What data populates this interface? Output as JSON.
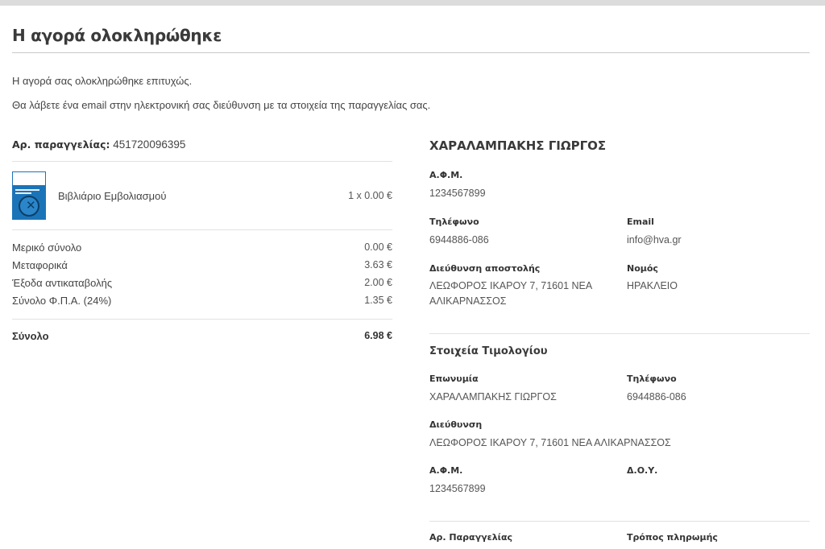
{
  "page": {
    "title": "Η αγορά ολοκληρώθηκε",
    "message_success": "Η αγορά σας ολοκληρώθηκε επιτυχώς.",
    "message_email": "Θα λάβετε ένα email στην ηλεκτρονική σας διεύθυνση με τα στοιχεία της παραγγελίας σας."
  },
  "order": {
    "number_label": "Αρ. παραγγελίας:",
    "number_value": "451720096395",
    "items": [
      {
        "name": "Βιβλιάριο Εμβολιασμού",
        "qty_price": "1 x 0.00 €",
        "thumb_icon": "vaccination-booklet-thumbnail"
      }
    ],
    "summary": [
      {
        "label": "Μερικό σύνολο",
        "value": "0.00 €"
      },
      {
        "label": "Μεταφορικά",
        "value": "3.63 €"
      },
      {
        "label": "Έξοδα αντικαταβολής",
        "value": "2.00 €"
      },
      {
        "label": "Σύνολο Φ.Π.Α. (24%)",
        "value": "1.35 €"
      }
    ],
    "total": {
      "label": "Σύνολο",
      "value": "6.98 €"
    }
  },
  "customer": {
    "name": "ΧΑΡΑΛΑΜΠΑΚΗΣ ΓΙΩΡΓΟΣ",
    "afm_label": "Α.Φ.Μ.",
    "afm_value": "1234567899",
    "phone_label": "Τηλέφωνο",
    "phone_value": "6944886-086",
    "email_label": "Email",
    "email_value": "info@hva.gr",
    "shipping_label": "Διεύθυνση αποστολής",
    "shipping_line1": "ΛΕΩΦΟΡΟΣ ΙΚΑΡΟΥ 7, 71601 ΝΕΑ",
    "shipping_line2": "ΑΛΙΚΑΡΝΑΣΣΟΣ",
    "nomos_label": "Νομός",
    "nomos_value": "ΗΡΑΚΛΕΙΟ"
  },
  "invoice": {
    "title": "Στοιχεία Τιμολογίου",
    "company_label": "Επωνυμία",
    "company_value": "ΧΑΡΑΛΑΜΠΑΚΗΣ ΓΙΩΡΓΟΣ",
    "phone_label": "Τηλέφωνο",
    "phone_value": "6944886-086",
    "address_label": "Διεύθυνση",
    "address_value": "ΛΕΩΦΟΡΟΣ ΙΚΑΡΟΥ 7, 71601 ΝΕΑ ΑΛΙΚΑΡΝΑΣΣΟΣ",
    "afm_label": "Α.Φ.Μ.",
    "afm_value": "1234567899",
    "doy_label": "Δ.Ο.Υ.",
    "doy_value": ""
  },
  "extra": {
    "order_label": "Αρ. Παραγγελίας",
    "payment_label": "Τρόπος πληρωμής"
  }
}
